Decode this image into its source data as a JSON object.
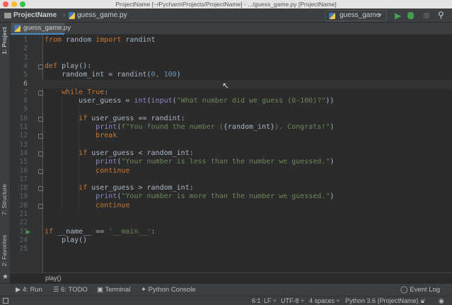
{
  "window": {
    "title": "ProjectName [~/PycharmProjects/ProjectName] - .../guess_game.py [ProjectName]"
  },
  "navbar": {
    "project": "ProjectName",
    "file": "guess_game.py",
    "run_config": "guess_game",
    "icons": [
      "folder-icon",
      "python-file-icon",
      "run-icon",
      "debug-icon",
      "stop-icon",
      "search-icon"
    ],
    "colors": {
      "run": "#499c54"
    }
  },
  "tabs": [
    {
      "label": "guess_game.py",
      "active": true
    }
  ],
  "left_strip": {
    "project": "1: Project",
    "structure": "7: Structure",
    "favorites": "2: Favorites"
  },
  "editor": {
    "current_line": 6,
    "lines": [
      [
        [
          "from",
          "kw"
        ],
        [
          " random ",
          "pl"
        ],
        [
          "import",
          "kw"
        ],
        [
          " randint",
          "pl"
        ]
      ],
      [],
      [],
      [
        [
          "def",
          "kw"
        ],
        [
          " play():",
          "pl"
        ]
      ],
      [
        [
          "    random_int = randint(",
          "pl"
        ],
        [
          "0",
          "num"
        ],
        [
          ", ",
          "kw"
        ],
        [
          "100",
          "num"
        ],
        [
          ")",
          "pl"
        ]
      ],
      [],
      [
        [
          "    ",
          "pl"
        ],
        [
          "while True",
          "kw"
        ],
        [
          ":",
          "pl"
        ]
      ],
      [
        [
          "        user_guess = ",
          "pl"
        ],
        [
          "int",
          "bi"
        ],
        [
          "(",
          "pl"
        ],
        [
          "input",
          "bi"
        ],
        [
          "(",
          "pl"
        ],
        [
          "\"What number did we guess (0-100)?\"",
          "str"
        ],
        [
          "))",
          "pl"
        ]
      ],
      [],
      [
        [
          "        ",
          "pl"
        ],
        [
          "if",
          "kw"
        ],
        [
          " user_guess == randint:",
          "pl"
        ]
      ],
      [
        [
          "            ",
          "pl"
        ],
        [
          "print",
          "bi"
        ],
        [
          "(",
          "pl"
        ],
        [
          "f\"You found the number (",
          "str"
        ],
        [
          "{random_int}",
          "pl"
        ],
        [
          "). Congrats!\"",
          "str"
        ],
        [
          ")",
          "pl"
        ]
      ],
      [
        [
          "            ",
          "pl"
        ],
        [
          "break",
          "kw"
        ]
      ],
      [],
      [
        [
          "        ",
          "pl"
        ],
        [
          "if",
          "kw"
        ],
        [
          " user_guess < random_int:",
          "pl"
        ]
      ],
      [
        [
          "            ",
          "pl"
        ],
        [
          "print",
          "bi"
        ],
        [
          "(",
          "pl"
        ],
        [
          "\"Your number is less than the number we guessed.\"",
          "str"
        ],
        [
          ")",
          "pl"
        ]
      ],
      [
        [
          "            ",
          "pl"
        ],
        [
          "continue",
          "kw"
        ]
      ],
      [],
      [
        [
          "        ",
          "pl"
        ],
        [
          "if",
          "kw"
        ],
        [
          " user_guess > random_int:",
          "pl"
        ]
      ],
      [
        [
          "            ",
          "pl"
        ],
        [
          "print",
          "bi"
        ],
        [
          "(",
          "pl"
        ],
        [
          "\"Your number is more than the number we guessed.\"",
          "str"
        ],
        [
          ")",
          "pl"
        ]
      ],
      [
        [
          "            ",
          "pl"
        ],
        [
          "continue",
          "kw"
        ]
      ],
      [],
      [],
      [
        [
          "if",
          "kw"
        ],
        [
          " __name__ == ",
          "pl"
        ],
        [
          "'__main__'",
          "str"
        ],
        [
          ":",
          "pl"
        ]
      ],
      [
        [
          "    play()",
          "pl"
        ]
      ],
      []
    ],
    "fold_lines": [
      4,
      7,
      10,
      12,
      14,
      16,
      18,
      20
    ],
    "run_gutter_line": 23,
    "breadcrumb": "play()"
  },
  "toolwindows": {
    "run": "4: Run",
    "todo": "6: TODO",
    "terminal": "Terminal",
    "console": "Python Console",
    "event_log": "Event Log"
  },
  "status": {
    "position": "6:1",
    "line_sep": "LF ÷",
    "encoding": "UTF-8 ÷",
    "indent": "4 spaces ÷",
    "interpreter": "Python 3.6 (ProjectName) ÷"
  },
  "colors": {
    "bg": "#2b2b2b",
    "keyword": "#cc7832",
    "string": "#6a8759",
    "number": "#6897bb",
    "builtin": "#8888c6",
    "text": "#a9b7c6"
  }
}
